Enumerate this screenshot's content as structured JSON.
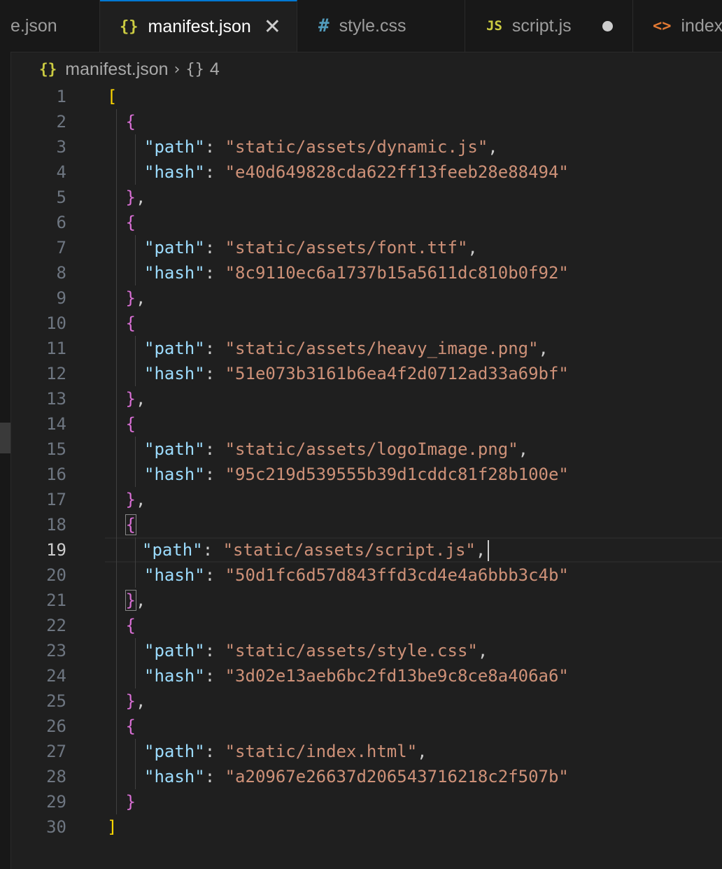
{
  "tabs": [
    {
      "label": "e.json",
      "icon": "json-braces-icon"
    },
    {
      "label": "manifest.json",
      "icon": "json-braces-icon",
      "active": true
    },
    {
      "label": "style.css",
      "icon": "css-hash-icon"
    },
    {
      "label": "script.js",
      "icon": "js-icon",
      "modified": true
    },
    {
      "label": "index",
      "icon": "html-angle-icon"
    }
  ],
  "tab_icons": {
    "json": "{}",
    "css": "#",
    "js": "JS",
    "html": "<>",
    "close": "✕",
    "chevron": "›"
  },
  "breadcrumb": {
    "file": "manifest.json",
    "symbol": "4",
    "symbol_icon": "{}"
  },
  "editor": {
    "current_line": 19,
    "lines": [
      {
        "n": "1"
      },
      {
        "n": "2"
      },
      {
        "n": "3"
      },
      {
        "n": "4"
      },
      {
        "n": "5"
      },
      {
        "n": "6"
      },
      {
        "n": "7"
      },
      {
        "n": "8"
      },
      {
        "n": "9"
      },
      {
        "n": "10"
      },
      {
        "n": "11"
      },
      {
        "n": "12"
      },
      {
        "n": "13"
      },
      {
        "n": "14"
      },
      {
        "n": "15"
      },
      {
        "n": "16"
      },
      {
        "n": "17"
      },
      {
        "n": "18"
      },
      {
        "n": "19"
      },
      {
        "n": "20"
      },
      {
        "n": "21"
      },
      {
        "n": "22"
      },
      {
        "n": "23"
      },
      {
        "n": "24"
      },
      {
        "n": "25"
      },
      {
        "n": "26"
      },
      {
        "n": "27"
      },
      {
        "n": "28"
      },
      {
        "n": "29"
      },
      {
        "n": "30"
      }
    ],
    "entries": [
      {
        "path": "\"static/assets/dynamic.js\"",
        "hash": "\"e40d649828cda622ff13feeb28e88494\""
      },
      {
        "path": "\"static/assets/font.ttf\"",
        "hash": "\"8c9110ec6a1737b15a5611dc810b0f92\""
      },
      {
        "path": "\"static/assets/heavy_image.png\"",
        "hash": "\"51e073b3161b6ea4f2d0712ad33a69bf\""
      },
      {
        "path": "\"static/assets/logoImage.png\"",
        "hash": "\"95c219d539555b39d1cddc81f28b100e\""
      },
      {
        "path": "\"static/assets/script.js\"",
        "hash": "\"50d1fc6d57d843ffd3cd4e4a6bbb3c4b\""
      },
      {
        "path": "\"static/assets/style.css\"",
        "hash": "\"3d02e13aeb6bc2fd13be9c8ce8a406a6\""
      },
      {
        "path": "\"static/index.html\"",
        "hash": "\"a20967e26637d206543716218c2f507b\""
      }
    ],
    "tokens": {
      "open_array": "[",
      "close_array": "]",
      "open_obj": "{",
      "close_obj": "}",
      "comma": ",",
      "colon": ": ",
      "path_key": "\"path\"",
      "hash_key": "\"hash\""
    }
  },
  "colors": {
    "background": "#1f1f1f",
    "tab_accent": "#0078d4",
    "bracket_gold": "#ffd700",
    "bracket_purple": "#da70d6",
    "json_key": "#9cdcfe",
    "json_string": "#ce9178"
  }
}
